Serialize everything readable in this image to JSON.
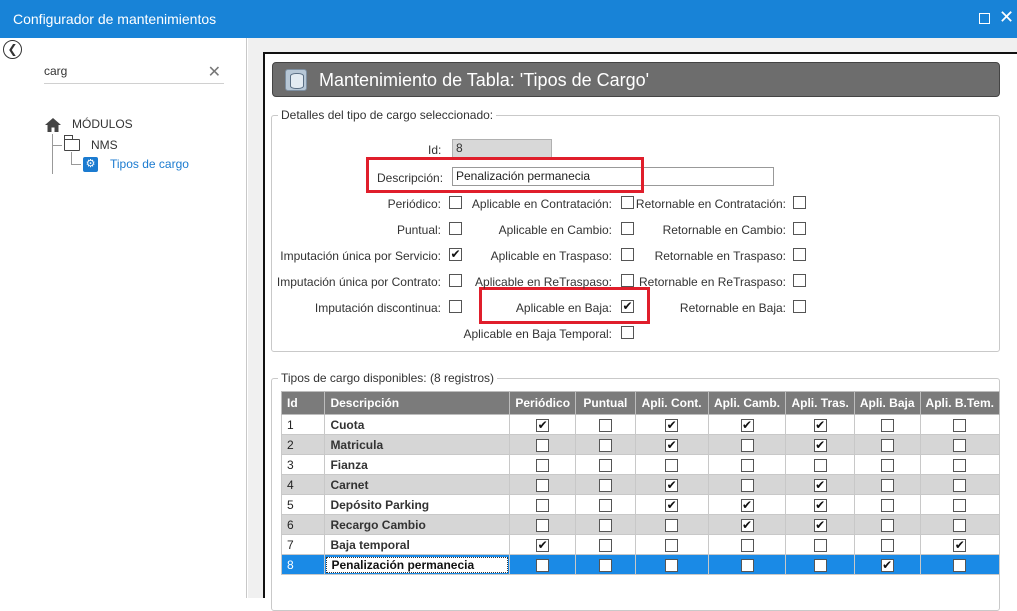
{
  "window": {
    "title": "Configurador de mantenimientos",
    "maximize_glyph": "□",
    "close_glyph": "✕"
  },
  "sidebar": {
    "search": {
      "value": "carg",
      "clear_glyph": "✕"
    },
    "tree": {
      "root": "MÓDULOS",
      "folder": "NMS",
      "leaf": "Tipos de cargo"
    }
  },
  "header": {
    "title": "Mantenimiento de Tabla: 'Tipos de Cargo'"
  },
  "details": {
    "legend": "Detalles del tipo de cargo seleccionado:",
    "id_label": "Id:",
    "id_value": "8",
    "desc_label": "Descripción:",
    "desc_value": "Penalización permanecia",
    "col1": [
      {
        "label": "Periódico:",
        "checked": false
      },
      {
        "label": "Puntual:",
        "checked": false
      },
      {
        "label": "Imputación única por Servicio:",
        "checked": true
      },
      {
        "label": "Imputación única por Contrato:",
        "checked": false
      },
      {
        "label": "Imputación discontinua:",
        "checked": false
      }
    ],
    "col2": [
      {
        "label": "Aplicable en Contratación:",
        "checked": false
      },
      {
        "label": "Aplicable en Cambio:",
        "checked": false
      },
      {
        "label": "Aplicable en Traspaso:",
        "checked": false
      },
      {
        "label": "Aplicable en ReTraspaso:",
        "checked": false
      },
      {
        "label": "Aplicable en Baja:",
        "checked": true
      },
      {
        "label": "Aplicable en Baja Temporal:",
        "checked": false
      }
    ],
    "col3": [
      {
        "label": "Retornable en Contratación:",
        "checked": false
      },
      {
        "label": "Retornable en Cambio:",
        "checked": false
      },
      {
        "label": "Retornable en Traspaso:",
        "checked": false
      },
      {
        "label": "Retornable en ReTraspaso:",
        "checked": false
      },
      {
        "label": "Retornable en Baja:",
        "checked": false
      }
    ]
  },
  "available": {
    "legend": "Tipos de cargo disponibles:  (8 registros)",
    "columns": [
      "Id",
      "Descripción",
      "Periódico",
      "Puntual",
      "Apli. Cont.",
      "Apli. Camb.",
      "Apli. Tras.",
      "Apli. Baja",
      "Apli. B.Tem."
    ],
    "rows": [
      {
        "id": "1",
        "desc": "Cuota",
        "flags": [
          true,
          false,
          true,
          true,
          true,
          false,
          false
        ]
      },
      {
        "id": "2",
        "desc": "Matricula",
        "flags": [
          false,
          false,
          true,
          false,
          true,
          false,
          false
        ]
      },
      {
        "id": "3",
        "desc": "Fianza",
        "flags": [
          false,
          false,
          false,
          false,
          false,
          false,
          false
        ]
      },
      {
        "id": "4",
        "desc": "Carnet",
        "flags": [
          false,
          false,
          true,
          false,
          true,
          false,
          false
        ]
      },
      {
        "id": "5",
        "desc": "Depósito Parking",
        "flags": [
          false,
          false,
          true,
          true,
          true,
          false,
          false
        ]
      },
      {
        "id": "6",
        "desc": "Recargo Cambio",
        "flags": [
          false,
          false,
          false,
          true,
          true,
          false,
          false
        ]
      },
      {
        "id": "7",
        "desc": "Baja temporal",
        "flags": [
          true,
          false,
          false,
          false,
          false,
          false,
          true
        ]
      },
      {
        "id": "8",
        "desc": "Penalización permanecia",
        "flags": [
          false,
          false,
          false,
          false,
          false,
          true,
          false
        ],
        "selected": true
      }
    ]
  },
  "colors": {
    "titlebar": "#1883d7",
    "highlight": "#e01e2b",
    "selected_row": "#1a8ae6",
    "header_bg": "#6d6d6d",
    "grid_header": "#7b7b7b"
  }
}
